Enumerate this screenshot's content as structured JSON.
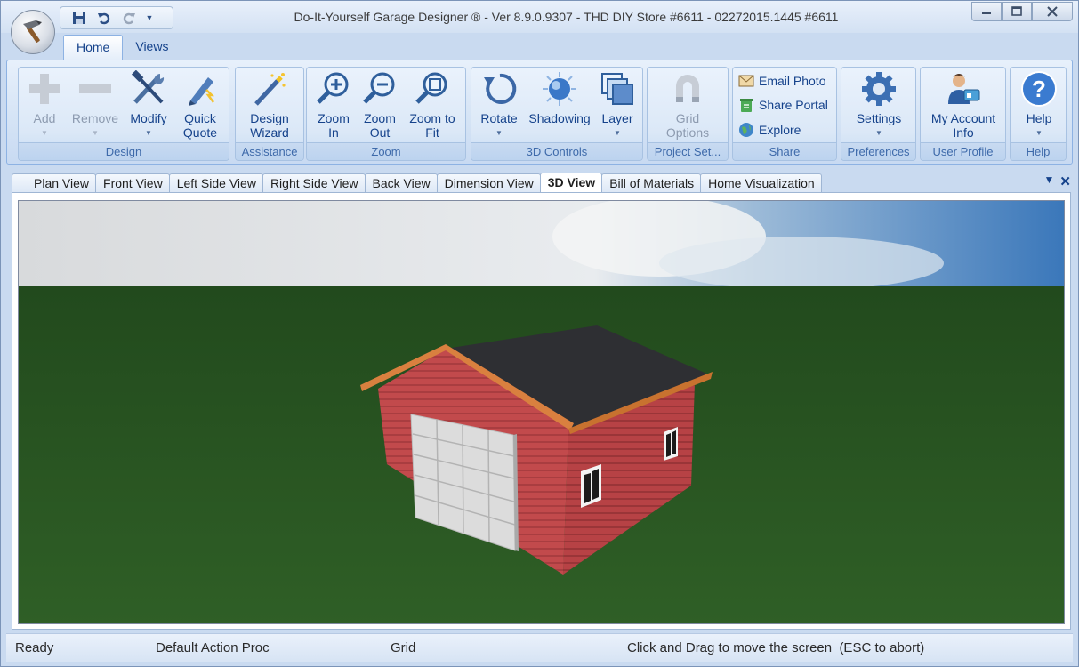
{
  "window": {
    "title": "Do-It-Yourself Garage Designer ® - Ver 8.9.0.9307 - THD DIY Store #6611 - 02272015.1445 #6611",
    "controls": [
      "minimize-icon",
      "maximize-icon",
      "close-icon"
    ]
  },
  "qat": {
    "items": [
      "save-icon",
      "undo-icon",
      "redo-icon",
      "customize-dropdown-icon"
    ]
  },
  "ribbon": {
    "tabs": [
      {
        "label": "Home",
        "active": true
      },
      {
        "label": "Views",
        "active": false
      }
    ],
    "groups": {
      "design": {
        "label": "Design",
        "add": {
          "line1": "Add",
          "icon": "plus-icon",
          "enabled": false
        },
        "remove": {
          "line1": "Remove",
          "icon": "minus-icon",
          "enabled": false
        },
        "modify": {
          "line1": "Modify",
          "icon": "hammer-wrench-icon"
        },
        "quick_quote": {
          "line1": "Quick",
          "line2": "Quote",
          "icon": "quote-pen-icon"
        }
      },
      "assistance": {
        "label": "Assistance",
        "design_wizard": {
          "line1": "Design",
          "line2": "Wizard",
          "icon": "magic-wand-icon"
        }
      },
      "zoom": {
        "label": "Zoom",
        "zoom_in": {
          "line1": "Zoom",
          "line2": "In",
          "icon": "zoom-in-icon"
        },
        "zoom_out": {
          "line1": "Zoom",
          "line2": "Out",
          "icon": "zoom-out-icon"
        },
        "zoom_fit": {
          "line1": "Zoom to",
          "line2": "Fit",
          "icon": "zoom-fit-icon"
        }
      },
      "controls3d": {
        "label": "3D Controls",
        "rotate": {
          "line1": "Rotate",
          "icon": "rotate-icon"
        },
        "shadowing": {
          "line1": "Shadowing",
          "icon": "sun-icon"
        },
        "layer": {
          "line1": "Layer",
          "icon": "layers-icon"
        }
      },
      "project": {
        "label": "Project Set...",
        "grid_options": {
          "line1": "Grid",
          "line2": "Options",
          "icon": "magnet-icon",
          "enabled": false
        }
      },
      "share": {
        "label": "Share",
        "email_photo": {
          "label": "Email Photo",
          "icon": "email-photo-icon"
        },
        "share_portal": {
          "label": "Share Portal",
          "icon": "recycle-icon"
        },
        "explore": {
          "label": "Explore",
          "icon": "globe-icon"
        }
      },
      "preferences": {
        "label": "Preferences",
        "settings": {
          "line1": "Settings",
          "icon": "gear-icon"
        }
      },
      "user_profile": {
        "label": "User Profile",
        "my_account": {
          "line1": "My Account",
          "line2": "Info",
          "icon": "user-card-icon"
        }
      },
      "help": {
        "label": "Help",
        "help": {
          "line1": "Help",
          "icon": "help-icon"
        }
      }
    }
  },
  "doc_tabs": [
    {
      "label": "Plan View",
      "active": false
    },
    {
      "label": "Front View",
      "active": false
    },
    {
      "label": "Left Side View",
      "active": false
    },
    {
      "label": "Right Side View",
      "active": false
    },
    {
      "label": "Back View",
      "active": false
    },
    {
      "label": "Dimension View",
      "active": false
    },
    {
      "label": "3D View",
      "active": true
    },
    {
      "label": "Bill of Materials",
      "active": false
    },
    {
      "label": "Home Visualization",
      "active": false
    }
  ],
  "doc_controls": [
    "tab-list-dropdown-icon",
    "close-tab-icon"
  ],
  "scene": {
    "description_icon": "garage-3d-model",
    "wall_color": "#c0474a",
    "roof_color": "#2d2e31",
    "trim_color": "#d9803f",
    "sky_color": "#3f7fc0",
    "grass_color": "#2b5a22"
  },
  "status": {
    "ready": "Ready",
    "action": "Default Action Proc",
    "grid": "Grid",
    "hint": "Click and Drag to move the screen  (ESC to abort)"
  }
}
